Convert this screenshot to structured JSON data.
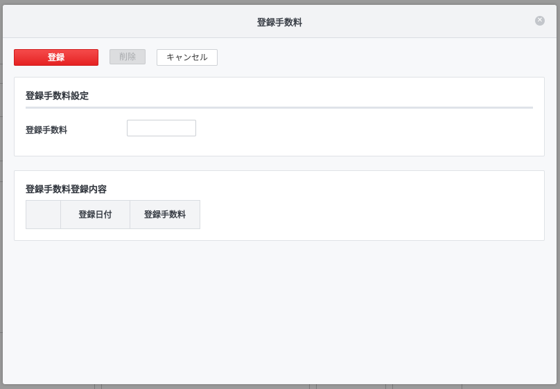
{
  "modal": {
    "title": "登録手数料",
    "close_icon": "close-circle-icon"
  },
  "toolbar": {
    "register_label": "登録",
    "delete_label": "削除",
    "cancel_label": "キャンセル"
  },
  "settings_panel": {
    "title": "登録手数料設定",
    "field_label": "登録手数料",
    "field_value": "",
    "field_placeholder": ""
  },
  "history_panel": {
    "title": "登録手数料登録内容",
    "columns": [
      "",
      "登録日付",
      "登録手数料"
    ]
  },
  "colors": {
    "primary": "#e52222",
    "disabled": "#dcdddf"
  }
}
